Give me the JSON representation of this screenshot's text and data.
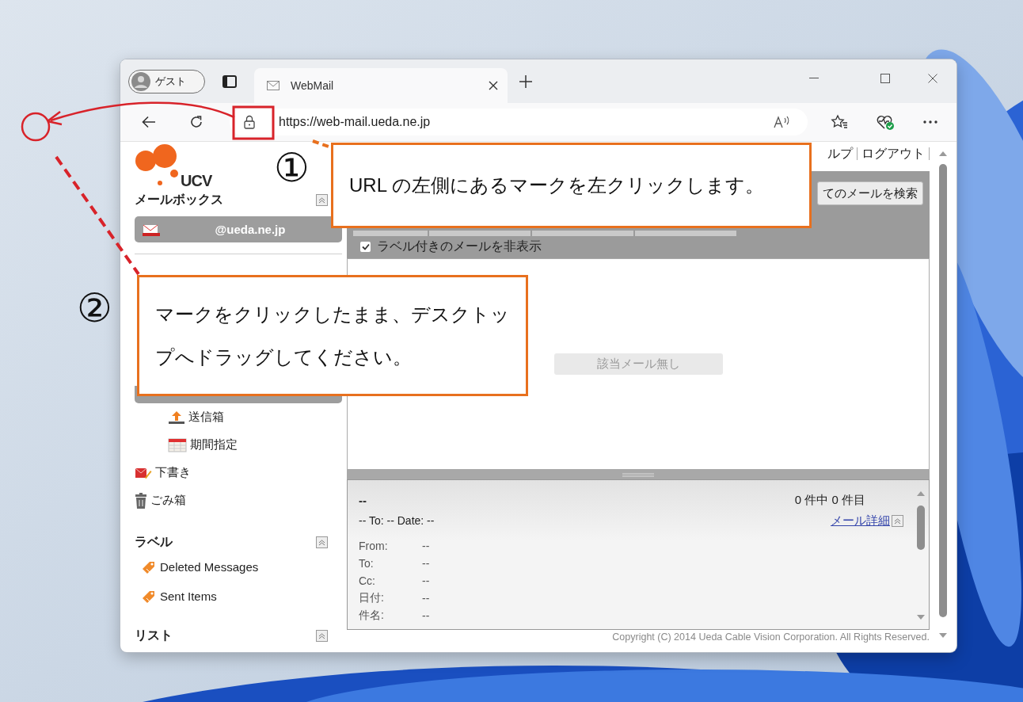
{
  "browser": {
    "profile": "ゲスト",
    "tabs": [
      {
        "title": "WebMail",
        "selected": true
      }
    ],
    "address": "https://web-mail.ueda.ne.jp"
  },
  "webmail": {
    "logo_text": "UCV",
    "mailbox_heading": "メールボックス",
    "account": "@ueda.ne.jp",
    "subfolders": [
      {
        "label": "送信箱",
        "kind": "outbox"
      },
      {
        "label": "期間指定",
        "kind": "period"
      }
    ],
    "folders": [
      {
        "label": "下書き",
        "kind": "draft"
      },
      {
        "label": "ごみ箱",
        "kind": "trash"
      }
    ],
    "labels_heading": "ラベル",
    "labels": [
      "Deleted Messages",
      "Sent Items"
    ],
    "list_heading": "リスト",
    "header_links": [
      "ルプ",
      "ログアウト"
    ],
    "search_button": "てのメールを検索",
    "hide_labeled": {
      "label": "ラベル付きのメールを非表示",
      "checked": true
    },
    "empty_message": "該当メール無し",
    "preview": {
      "subject": "--",
      "counter": "0 件中 0 件目",
      "summary": "-- To: -- Date: --",
      "details_link": "メール詳細",
      "fields": [
        {
          "name": "From:",
          "value": "--"
        },
        {
          "name": "To:",
          "value": "--"
        },
        {
          "name": "Cc:",
          "value": "--"
        },
        {
          "name": "日付:",
          "value": "--"
        },
        {
          "name": "件名:",
          "value": "--"
        }
      ]
    },
    "copyright": "Copyright (C) 2014 Ueda Cable Vision Corporation. All Rights Reserved."
  },
  "annotations": [
    {
      "number": "①",
      "text": "URL の左側にあるマークを左クリックします。"
    },
    {
      "number": "②",
      "text": "マークをクリックしたまま、デスクトップへドラッグしてください。"
    }
  ]
}
